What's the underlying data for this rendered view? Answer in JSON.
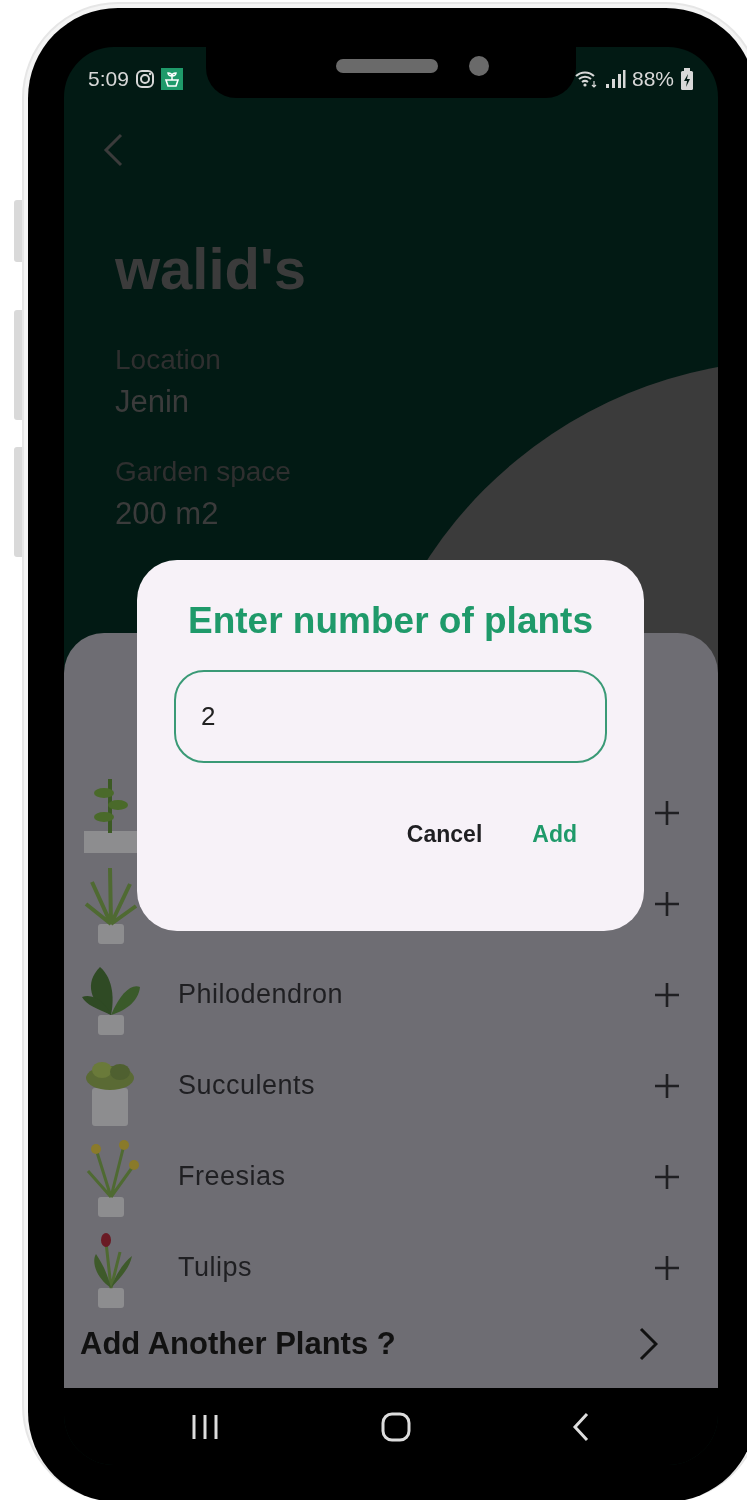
{
  "status_bar": {
    "time": "5:09",
    "battery": "88%"
  },
  "header": {
    "title": "walid's",
    "fields": [
      {
        "label": "Location",
        "value": "Jenin"
      },
      {
        "label": "Garden space",
        "value": "200 m2"
      }
    ]
  },
  "plants": [
    {
      "kind": "picture"
    },
    {
      "kind": "picture"
    },
    {
      "kind": "picture",
      "name": "Philodendron"
    },
    {
      "kind": "picture",
      "name": "Succulents"
    },
    {
      "kind": "picture",
      "name": "Freesias"
    },
    {
      "kind": "picture",
      "name": "Tulips"
    }
  ],
  "add_another": "Add Another Plants ?",
  "dialog": {
    "title": "Enter number of plants",
    "field": {
      "value": "2"
    },
    "buttons": [
      {
        "label": "Cancel",
        "kind": "secondary"
      },
      {
        "label": "Add",
        "kind": "primary"
      }
    ]
  }
}
